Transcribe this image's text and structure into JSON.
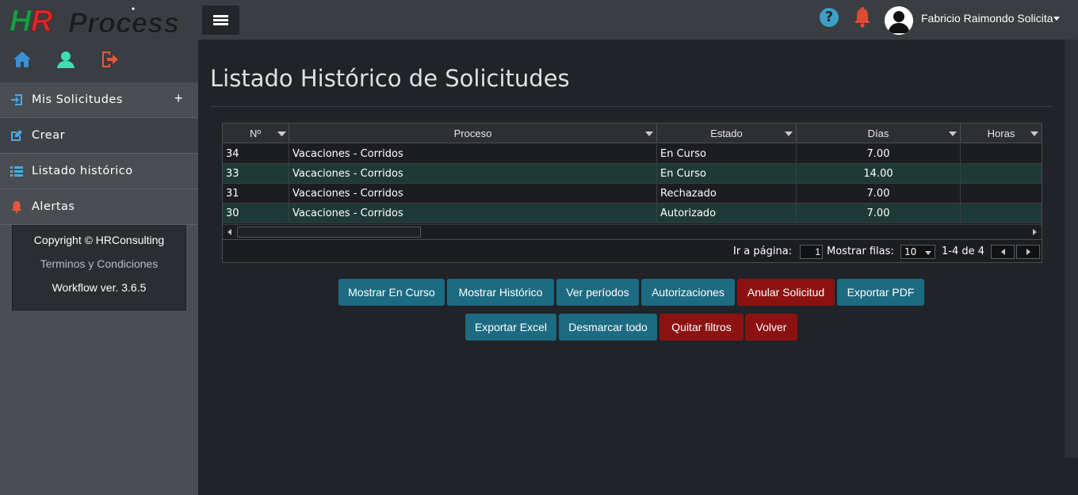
{
  "app": {
    "logo_text": "HR Process",
    "colors": {
      "accent_teal": "#1d6b82",
      "accent_red": "#8c1212",
      "row_alt": "#1e3a36"
    }
  },
  "topbar": {
    "menu_icon": "hamburger-icon",
    "help_icon": "question-circle-icon",
    "help_glyph": "?",
    "bell_icon": "bell-icon",
    "avatar_icon": "user-avatar-icon",
    "user_name": "Fabricio Raimondo Solicita"
  },
  "sidebar": {
    "quick_icons": [
      "home-icon",
      "user-icon",
      "logout-icon"
    ],
    "items": [
      {
        "label": "Mis Solicitudes",
        "icon": "sign-in-icon",
        "expand": "+"
      },
      {
        "label": "Crear",
        "icon": "edit-icon"
      },
      {
        "label": "Listado histórico",
        "icon": "list-icon"
      },
      {
        "label": "Alertas",
        "icon": "bell-icon"
      }
    ],
    "footer": {
      "copyright": "Copyright © HRConsulting",
      "terms": "Terminos y Condiciones",
      "version": "Workflow ver. 3.6.5"
    }
  },
  "main": {
    "title": "Listado Histórico de Solicitudes",
    "grid": {
      "columns": [
        "Nº",
        "Proceso",
        "Estado",
        "Días",
        "Horas"
      ],
      "rows": [
        {
          "no": "34",
          "proceso": "Vacaciones - Corridos",
          "estado": "En Curso",
          "dias": "7.00",
          "horas": ""
        },
        {
          "no": "33",
          "proceso": "Vacaciones - Corridos",
          "estado": "En Curso",
          "dias": "14.00",
          "horas": ""
        },
        {
          "no": "31",
          "proceso": "Vacaciones - Corridos",
          "estado": "Rechazado",
          "dias": "7.00",
          "horas": ""
        },
        {
          "no": "30",
          "proceso": "Vacaciones - Corridos",
          "estado": "Autorizado",
          "dias": "7.00",
          "horas": ""
        }
      ],
      "pager": {
        "goto_label": "Ir a página:",
        "goto_value": "1",
        "rows_label": "Mostrar filas:",
        "rows_value": "10",
        "range": "1-4 de 4"
      }
    },
    "buttons_row1": [
      {
        "label": "Mostrar En Curso",
        "style": "teal"
      },
      {
        "label": "Mostrar Histórico",
        "style": "teal"
      },
      {
        "label": "Ver períodos",
        "style": "teal"
      },
      {
        "label": "Autorizaciones",
        "style": "teal"
      },
      {
        "label": "Anular Solicitud",
        "style": "red"
      },
      {
        "label": "Exportar PDF",
        "style": "teal"
      }
    ],
    "buttons_row2": [
      {
        "label": "Exportar Excel",
        "style": "teal"
      },
      {
        "label": "Desmarcar todo",
        "style": "teal"
      },
      {
        "label": "Quitar filtros",
        "style": "red"
      },
      {
        "label": "Volver",
        "style": "red"
      }
    ]
  }
}
